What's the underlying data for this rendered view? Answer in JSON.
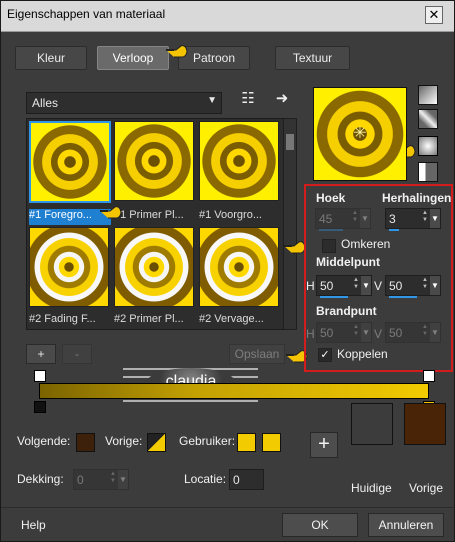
{
  "window": {
    "title": "Eigenschappen van materiaal",
    "close_label": "✕"
  },
  "tabs": [
    {
      "label": "Kleur"
    },
    {
      "label": "Verloop"
    },
    {
      "label": "Patroon"
    },
    {
      "label": "Textuur"
    }
  ],
  "gallery": {
    "filter": "Alles",
    "items": [
      {
        "label": "#1 Foregro..."
      },
      {
        "label": "#1 Primer Pl..."
      },
      {
        "label": "#1 Voorgro..."
      },
      {
        "label": "#2 Fading F..."
      },
      {
        "label": "#2 Primer Pl..."
      },
      {
        "label": "#2 Vervage..."
      }
    ]
  },
  "settings": {
    "angle_label": "Hoek",
    "angle_value": "45",
    "repeats_label": "Herhalingen",
    "repeats_value": "3",
    "invert_label": "Omkeren",
    "center_label": "Middelpunt",
    "center_h": "50",
    "center_v": "50",
    "focus_label": "Brandpunt",
    "focus_h": "50",
    "focus_v": "50",
    "link_label": "Koppelen",
    "h": "H",
    "v": "V"
  },
  "bottom": {
    "next_label": "Volgende:",
    "prev_label": "Vorige:",
    "user_label": "Gebruiker:",
    "opacity_label": "Dekking:",
    "opacity_value": "0",
    "location_label": "Locatie:",
    "location_value": "0",
    "current_label": "Huidige",
    "previous_label": "Vorige"
  },
  "buttons": {
    "help": "Help",
    "ok": "OK",
    "cancel": "Annuleren",
    "plus": "+",
    "minus": "-",
    "save_faint": "Opslaan"
  },
  "watermark": {
    "text": "claudia"
  },
  "colors": {
    "yellow": "#f2cb00",
    "dark_brown": "#4a2407",
    "selected_blue": "#2e95e9",
    "red_box": "#d31d1d"
  }
}
